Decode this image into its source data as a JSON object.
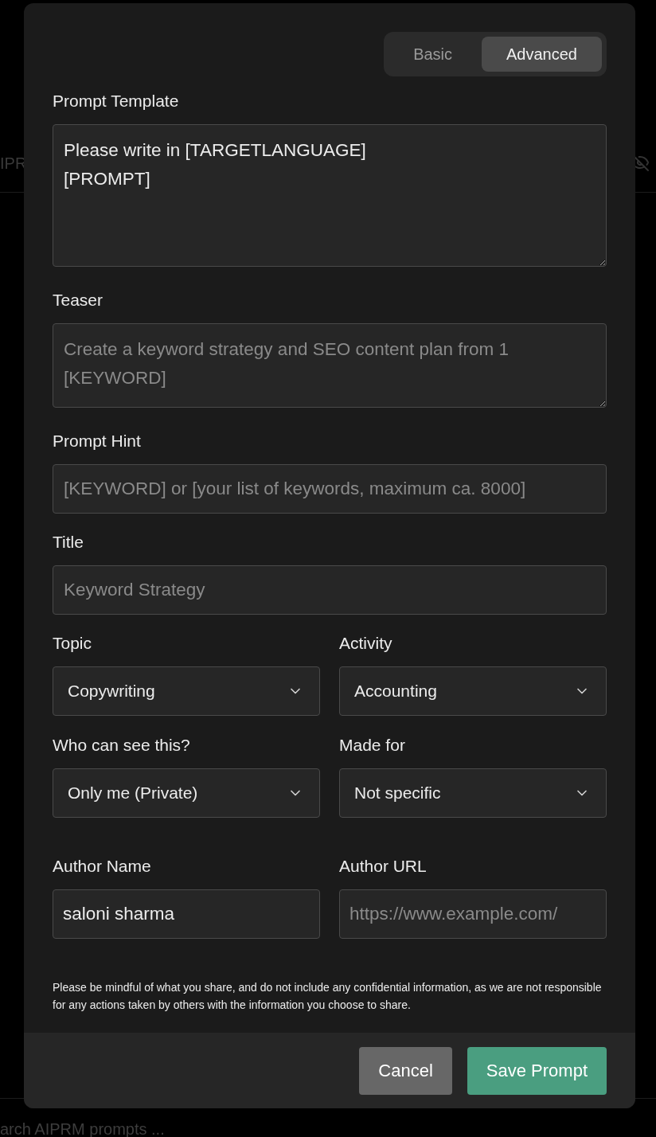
{
  "background": {
    "side_text": "IPR",
    "search_placeholder": "arch AIPRM prompts ..."
  },
  "mode_tabs": [
    {
      "label": "Basic",
      "selected": false
    },
    {
      "label": "Advanced",
      "selected": true
    }
  ],
  "fields": [
    {
      "kind": "large_textarea",
      "label": "Prompt Template",
      "value": "Please write in [TARGETLANGUAGE]\n[PROMPT]"
    },
    {
      "kind": "textarea",
      "label": "Teaser",
      "placeholder": "Create a keyword strategy and SEO content plan from 1 [KEYWORD]"
    },
    {
      "kind": "input",
      "label": "Prompt Hint",
      "placeholder": "[KEYWORD] or [your list of keywords, maximum ca. 8000]"
    },
    {
      "kind": "input",
      "label": "Title",
      "placeholder": "Keyword Strategy"
    }
  ],
  "selects": [
    {
      "label": "Topic",
      "value": "Copywriting"
    },
    {
      "label": "Activity",
      "value": "Accounting"
    },
    {
      "label": "Who can see this?",
      "value": "Only me (Private)"
    },
    {
      "label": "Made for",
      "value": "Not specific"
    }
  ],
  "author": [
    {
      "label": "Author Name",
      "value": "saloni sharma"
    },
    {
      "label": "Author URL",
      "placeholder": "https://www.example.com/"
    }
  ],
  "notice": "Please be mindful of what you share, and do not include any confidential information, as we are not responsible for any actions taken by others with the information you choose to share.",
  "buttons": [
    {
      "label": "Cancel",
      "kind": "secondary"
    },
    {
      "label": "Save Prompt",
      "kind": "primary"
    }
  ]
}
